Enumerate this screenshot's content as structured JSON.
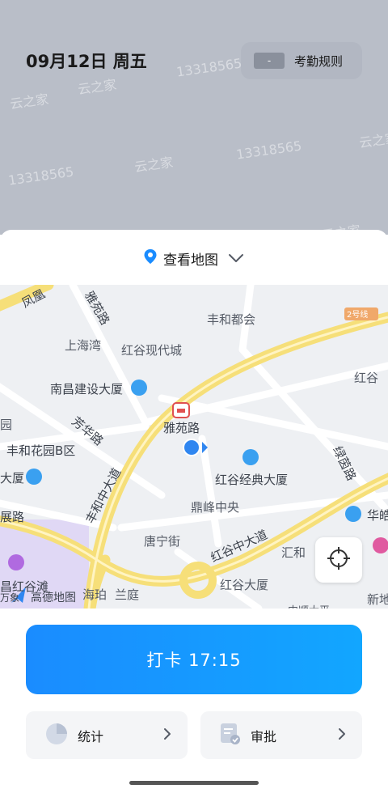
{
  "header": {
    "date": "09月12日 周五",
    "rules_chip": "-",
    "rules_label": "考勤规则",
    "watermarks": [
      "13318565",
      "云之家",
      "13318565",
      "云之家",
      "13318565",
      "云之家",
      "云之家",
      "云之家"
    ]
  },
  "map_toggle": {
    "label": "查看地图"
  },
  "map": {
    "labels": {
      "fenghuang": "凤凰",
      "yayuan_road_top": "雅苑路",
      "fenghe_du": "丰和都会",
      "shanghai_wan": "上海湾",
      "honggu_xiandai": "红谷现代城",
      "line2": "2号线",
      "honggu_right": "红谷",
      "nanchang_jianshe": "南昌建设大厦",
      "fanghua_road": "芳华路",
      "yayuan_road_station": "雅苑路",
      "fenghe_huayuan": "丰和花园B区",
      "yuan_left": "园",
      "dasha_left": "大厦",
      "honggu_jingdian": "红谷经典大厦",
      "fenghe_zhong": "丰和中大道",
      "lvyin_road": "绿茵路",
      "dingfeng": "鼎峰中央",
      "honggu_zhong": "红谷中大道",
      "huayu_right": "华皓",
      "zhan_road": "展路",
      "tangning": "唐宁街",
      "huihe": "汇和",
      "hongguwan": "昌红谷滩",
      "hongguwan_sub": "万象",
      "gaode": "高德地图",
      "haipo": "海珀",
      "lanting": "兰庭",
      "honggu_dasha": "红谷大厦",
      "xindi_right": "新地",
      "zhongshun": "中顺大平"
    }
  },
  "punch": {
    "label": "打卡  17:15"
  },
  "tiles": [
    {
      "label": "统计",
      "icon": "pie-chart-icon"
    },
    {
      "label": "审批",
      "icon": "approval-doc-icon"
    }
  ],
  "colors": {
    "accent": "#1a8cff",
    "header_bg": "#b9bec8",
    "road_yellow": "#f6df79"
  }
}
